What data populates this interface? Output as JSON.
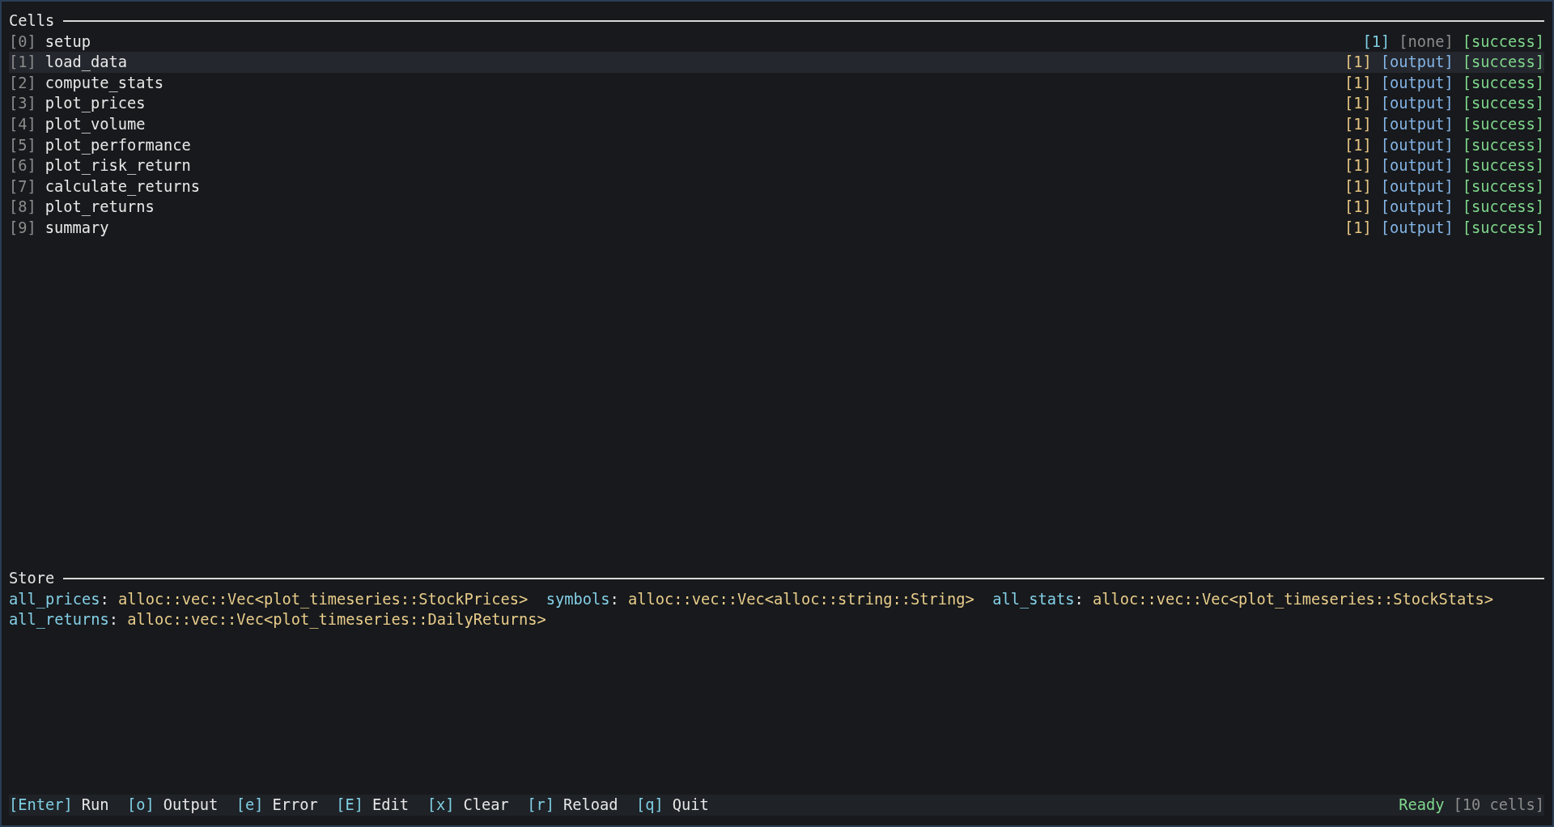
{
  "cells_panel": {
    "title": "Cells",
    "cells": [
      {
        "index": "[0]",
        "name": "setup",
        "selected": false,
        "count": {
          "text": "[1]",
          "color": "#7fcfe3"
        },
        "output": {
          "text": "[none]",
          "color": "#8c8c8c"
        },
        "status": {
          "text": "[success]",
          "color": "#7fd68c"
        }
      },
      {
        "index": "[1]",
        "name": "load_data",
        "selected": true,
        "count": {
          "text": "[1]",
          "color": "#e6c583"
        },
        "output": {
          "text": "[output]",
          "color": "#84b4e6"
        },
        "status": {
          "text": "[success]",
          "color": "#7fd68c"
        }
      },
      {
        "index": "[2]",
        "name": "compute_stats",
        "selected": false,
        "count": {
          "text": "[1]",
          "color": "#e6c583"
        },
        "output": {
          "text": "[output]",
          "color": "#84b4e6"
        },
        "status": {
          "text": "[success]",
          "color": "#7fd68c"
        }
      },
      {
        "index": "[3]",
        "name": "plot_prices",
        "selected": false,
        "count": {
          "text": "[1]",
          "color": "#e6c583"
        },
        "output": {
          "text": "[output]",
          "color": "#84b4e6"
        },
        "status": {
          "text": "[success]",
          "color": "#7fd68c"
        }
      },
      {
        "index": "[4]",
        "name": "plot_volume",
        "selected": false,
        "count": {
          "text": "[1]",
          "color": "#e6c583"
        },
        "output": {
          "text": "[output]",
          "color": "#84b4e6"
        },
        "status": {
          "text": "[success]",
          "color": "#7fd68c"
        }
      },
      {
        "index": "[5]",
        "name": "plot_performance",
        "selected": false,
        "count": {
          "text": "[1]",
          "color": "#e6c583"
        },
        "output": {
          "text": "[output]",
          "color": "#84b4e6"
        },
        "status": {
          "text": "[success]",
          "color": "#7fd68c"
        }
      },
      {
        "index": "[6]",
        "name": "plot_risk_return",
        "selected": false,
        "count": {
          "text": "[1]",
          "color": "#e6c583"
        },
        "output": {
          "text": "[output]",
          "color": "#84b4e6"
        },
        "status": {
          "text": "[success]",
          "color": "#7fd68c"
        }
      },
      {
        "index": "[7]",
        "name": "calculate_returns",
        "selected": false,
        "count": {
          "text": "[1]",
          "color": "#e6c583"
        },
        "output": {
          "text": "[output]",
          "color": "#84b4e6"
        },
        "status": {
          "text": "[success]",
          "color": "#7fd68c"
        }
      },
      {
        "index": "[8]",
        "name": "plot_returns",
        "selected": false,
        "count": {
          "text": "[1]",
          "color": "#e6c583"
        },
        "output": {
          "text": "[output]",
          "color": "#84b4e6"
        },
        "status": {
          "text": "[success]",
          "color": "#7fd68c"
        }
      },
      {
        "index": "[9]",
        "name": "summary",
        "selected": false,
        "count": {
          "text": "[1]",
          "color": "#e6c583"
        },
        "output": {
          "text": "[output]",
          "color": "#84b4e6"
        },
        "status": {
          "text": "[success]",
          "color": "#7fd68c"
        }
      }
    ]
  },
  "store_panel": {
    "title": "Store",
    "entries": [
      {
        "name": "all_prices",
        "separator": ":",
        "type": "alloc::vec::Vec<plot_timeseries::StockPrices>"
      },
      {
        "name": "symbols",
        "separator": ":",
        "type": "alloc::vec::Vec<alloc::string::String>"
      },
      {
        "name": "all_stats",
        "separator": ":",
        "type": "alloc::vec::Vec<plot_timeseries::StockStats>"
      },
      {
        "name": "all_returns",
        "separator": ":",
        "type": "alloc::vec::Vec<plot_timeseries::DailyReturns>"
      }
    ]
  },
  "status_bar": {
    "hints": [
      {
        "key": "[Enter]",
        "label": "Run"
      },
      {
        "key": "[o]",
        "label": "Output"
      },
      {
        "key": "[e]",
        "label": "Error"
      },
      {
        "key": "[E]",
        "label": "Edit"
      },
      {
        "key": "[x]",
        "label": "Clear"
      },
      {
        "key": "[r]",
        "label": "Reload"
      },
      {
        "key": "[q]",
        "label": "Quit"
      }
    ],
    "state": "Ready",
    "cell_count": "[10 cells]"
  }
}
